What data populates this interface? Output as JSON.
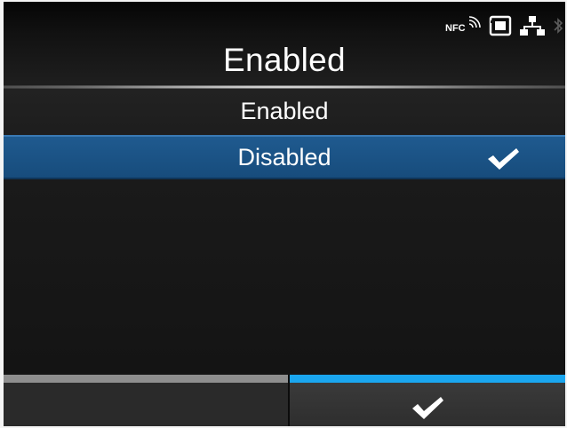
{
  "status_bar": {
    "nfc_label": "NFC",
    "icons": [
      "nfc-icon",
      "sd-card-icon",
      "network-icon",
      "bluetooth-icon"
    ]
  },
  "header": {
    "title": "Enabled"
  },
  "options": [
    {
      "label": "Enabled",
      "selected": false
    },
    {
      "label": "Disabled",
      "selected": true
    }
  ],
  "footer": {
    "left_button": "",
    "right_button_icon": "checkmark-icon"
  },
  "colors": {
    "selection": "#1f5a8f",
    "accent": "#1aa6ef",
    "background": "#151515"
  }
}
